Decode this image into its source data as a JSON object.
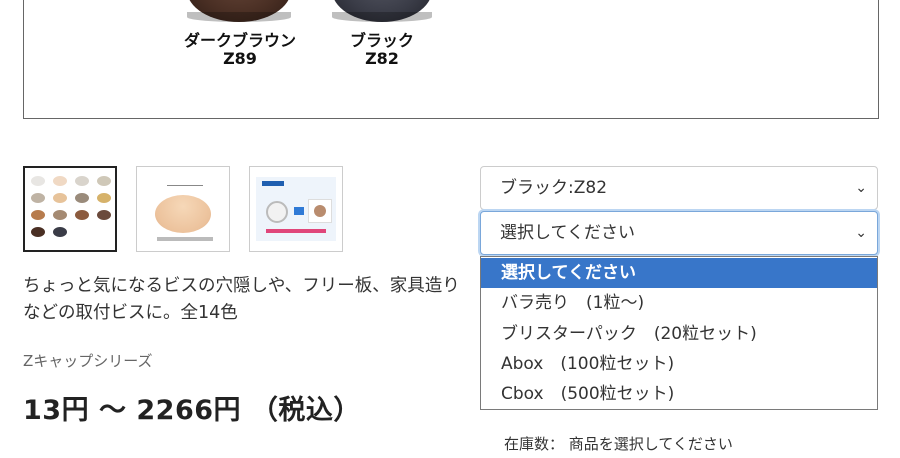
{
  "swatches": [
    {
      "name": "ダークブラウン",
      "code": "Z89",
      "color": "#4a2f24"
    },
    {
      "name": "ブラック",
      "code": "Z82",
      "color": "#3a3c47"
    }
  ],
  "thumbnail_grid_colors": [
    "#e8e6e3",
    "#f0d9c4",
    "#d9d4cc",
    "#cfc8b8",
    "#bfb3a4",
    "#e7c39a",
    "#9a8b7b",
    "#d6b26a",
    "#b77c4d",
    "#a58a72",
    "#8c5b3e",
    "#6b4a3c",
    "#4a2f24",
    "#3a3c47"
  ],
  "product": {
    "description": "ちょっと気になるビスの穴隠しや、フリー板、家具造りなどの取付ビスに。全14色",
    "series": "Zキャップシリーズ",
    "price": "13円 ～ 2266円 （税込）"
  },
  "selects": {
    "color_value": "ブラック:Z82",
    "pack_value": "選択してください"
  },
  "pack_options": [
    "選択してください",
    "バラ売り　(1粒～)",
    "ブリスターパック　(20粒セット)",
    "Abox　(100粒セット)",
    "Cbox　(500粒セット)"
  ],
  "stock_text": "在庫数：  商品を選択してください",
  "colors": {
    "accent": "#3876c9",
    "focus_border": "#7aa7da"
  }
}
